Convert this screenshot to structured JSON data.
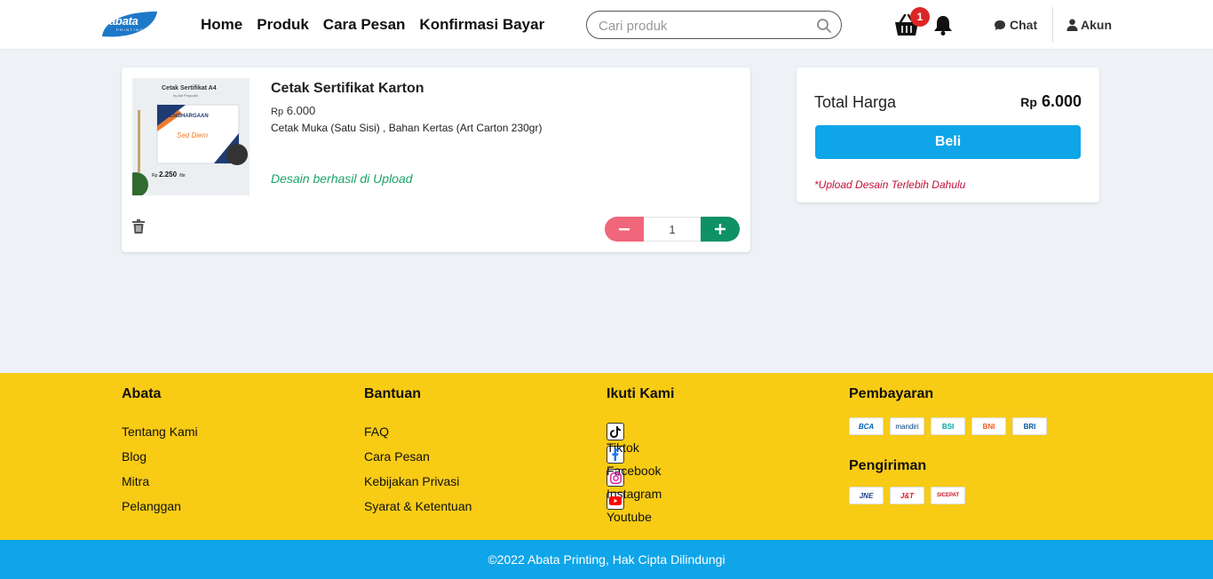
{
  "header": {
    "logo": {
      "text": "abata",
      "sub": "PRINTING"
    },
    "nav": [
      "Home",
      "Produk",
      "Cara Pesan",
      "Konfirmasi Bayar"
    ],
    "search_placeholder": "Cari produk",
    "cart_count": "1",
    "chat_label": "Chat",
    "account_label": "Akun",
    "icons": [
      "search-icon",
      "basket-icon",
      "bell-icon",
      "chat-icon",
      "user-icon"
    ]
  },
  "cart_item": {
    "name": "Cetak Sertifikat Karton",
    "price_currency": "Rp",
    "price_amount": "6.000",
    "options": "Cetak Muka (Satu Sisi) , Bahan Kertas (Art Carton 230gr)",
    "upload_status": "Desain berhasil di Upload",
    "quantity": "1",
    "thumbnail": {
      "title": "Cetak Sertifikat A4",
      "subtitle": "by Adi Prayudhi",
      "heading": "PENGHARGAAN",
      "name": "Sed Diem",
      "price_small": "Rp",
      "price": "2.250",
      "unit": "/lbr"
    }
  },
  "summary": {
    "label": "Total Harga",
    "currency": "Rp",
    "amount": "6.000",
    "buy_label": "Beli",
    "note": "*Upload Desain Terlebih Dahulu"
  },
  "footer": {
    "about": {
      "title": "Abata",
      "links": [
        "Tentang Kami",
        "Blog",
        "Mitra",
        "Pelanggan"
      ]
    },
    "help": {
      "title": "Bantuan",
      "links": [
        "FAQ",
        "Cara Pesan",
        "Kebijakan Privasi",
        "Syarat & Ketentuan"
      ]
    },
    "follow": {
      "title": "Ikuti Kami",
      "links": [
        "Tiktok",
        "Facebook",
        "Instagram",
        "Youtube"
      ]
    },
    "payment": {
      "title": "Pembayaran",
      "banks": [
        "BCA",
        "mandiri",
        "BSI",
        "BNI",
        "BRI"
      ]
    },
    "shipping": {
      "title": "Pengiriman",
      "couriers": [
        "JNE",
        "J&T",
        "SICEPAT"
      ]
    },
    "copyright": "©2022 Abata Printing, Hak Cipta Dilindungi"
  },
  "colors": {
    "accent": "#0ea5e9",
    "footer_bg": "#f8cb15",
    "minus": "#f0667a",
    "plus": "#0e9165",
    "success": "#1aa36e",
    "warning": "#c0113b",
    "badge": "#dc2626"
  }
}
